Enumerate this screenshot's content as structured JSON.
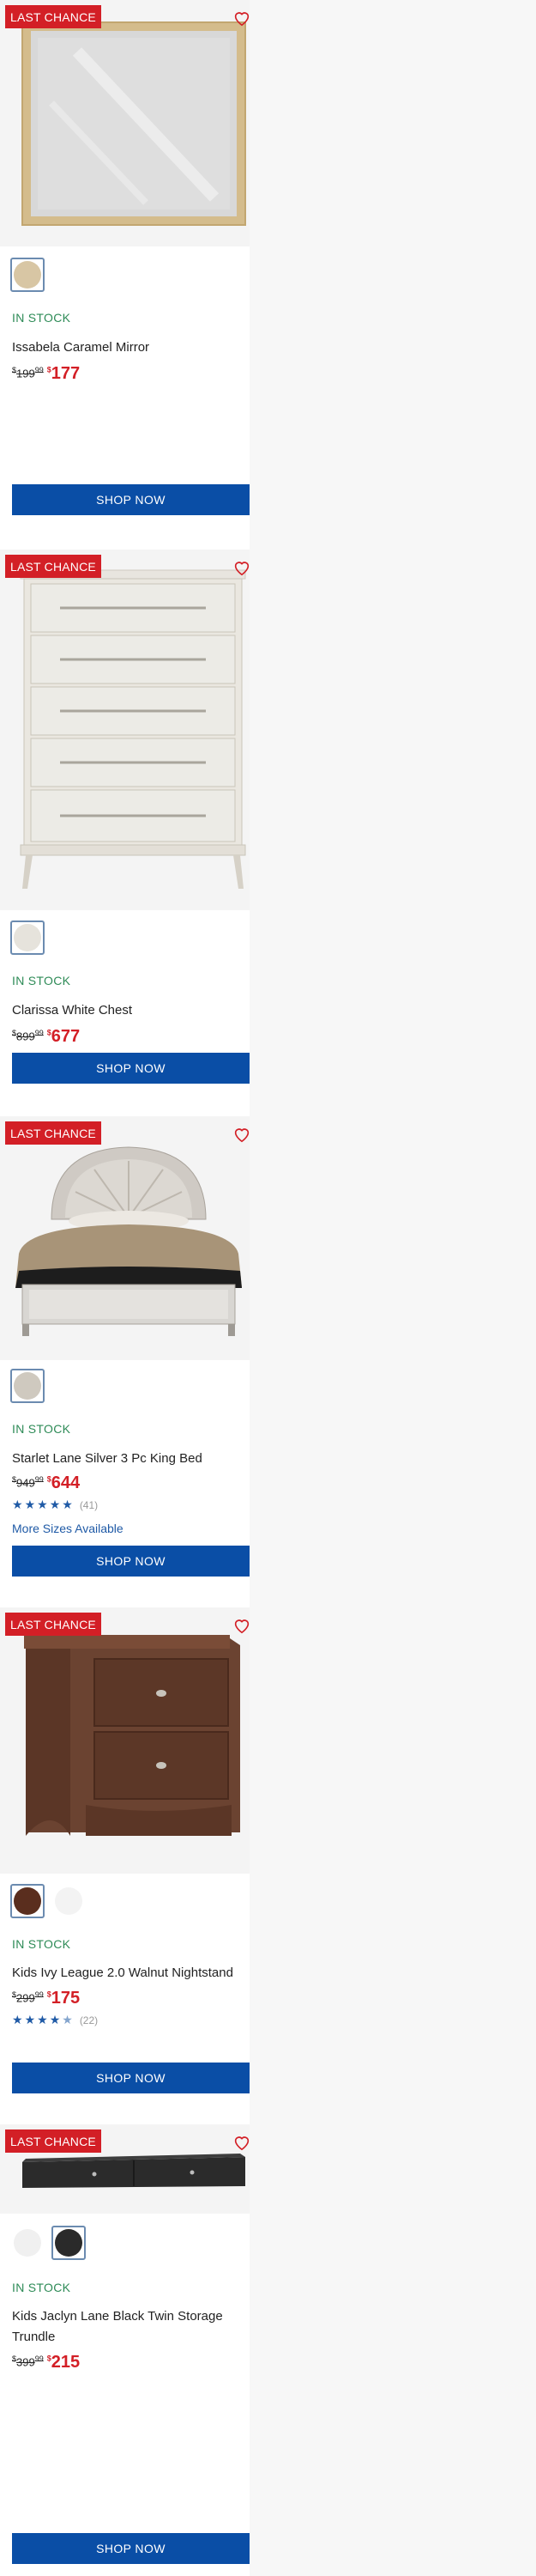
{
  "products": [
    {
      "badge": "LAST CHANCE",
      "stock": "IN STOCK",
      "name": "Issabela Caramel Mirror",
      "old_price": "199",
      "old_cents": "99",
      "new_price": "177",
      "cta": "SHOP NOW",
      "swatches": [
        "#d8c6a4"
      ]
    },
    {
      "badge": "LAST CHANCE",
      "stock": "IN STOCK",
      "name": "Clarissa White Chest",
      "old_price": "899",
      "old_cents": "99",
      "new_price": "677",
      "cta": "SHOP NOW",
      "swatches": [
        "#e6e3dc"
      ]
    },
    {
      "badge": "LAST CHANCE",
      "stock": "IN STOCK",
      "name": "Starlet Lane Silver 3 Pc King Bed",
      "old_price": "949",
      "old_cents": "99",
      "new_price": "644",
      "rating_count": "(41)",
      "rating": 5,
      "more_sizes": "More Sizes Available",
      "cta": "SHOP NOW",
      "swatches": [
        "#cfc9bf"
      ]
    },
    {
      "badge": "LAST CHANCE",
      "stock": "IN STOCK",
      "name": "Kids Ivy League 2.0 Walnut Nightstand",
      "old_price": "299",
      "old_cents": "99",
      "new_price": "175",
      "rating_count": "(22)",
      "rating": 4.5,
      "cta": "SHOP NOW",
      "swatches": [
        "#5a2e1e",
        "#f3f3f3"
      ]
    },
    {
      "badge": "LAST CHANCE",
      "stock": "IN STOCK",
      "name": "Kids Jaclyn Lane Black Twin Storage Trundle",
      "old_price": "399",
      "old_cents": "99",
      "new_price": "215",
      "cta": "SHOP NOW",
      "swatches": [
        "#f0f0f0",
        "#2a2a2a"
      ]
    }
  ],
  "colors": {
    "badge": "#d31f26",
    "in_stock": "#2e8b57",
    "cta": "#0a4ea6",
    "price": "#d31f26",
    "star": "#1f5aa6"
  }
}
